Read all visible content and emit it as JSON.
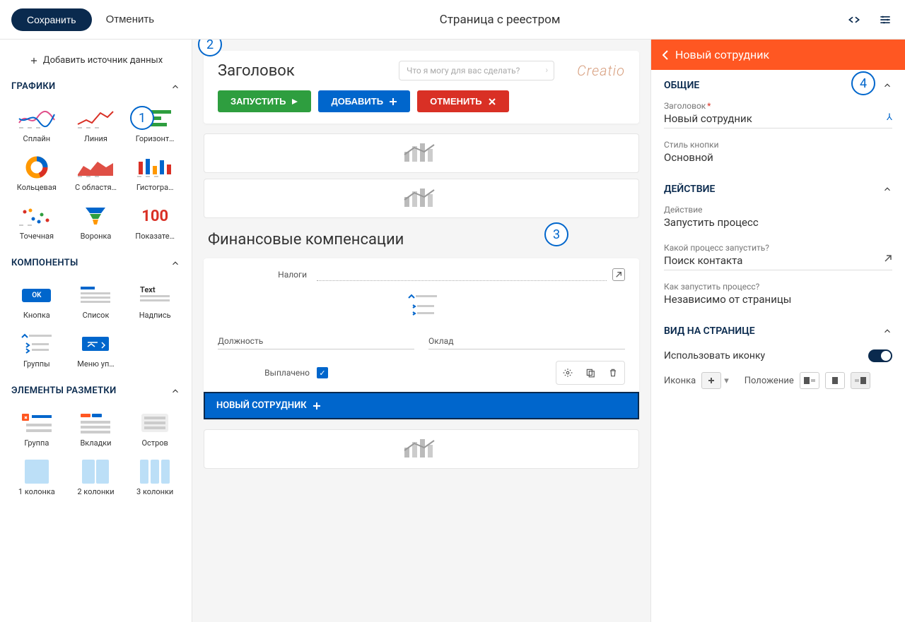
{
  "topbar": {
    "save": "Сохранить",
    "cancel": "Отменить",
    "title": "Страница с реестром"
  },
  "steps": [
    "1",
    "2",
    "3",
    "4"
  ],
  "left": {
    "add_source": "Добавить источник данных",
    "sections": {
      "graphics": "ГРАФИКИ",
      "components": "КОМПОНЕНТЫ",
      "layout": "ЭЛЕМЕНТЫ РАЗМЕТКИ"
    },
    "graphics": [
      {
        "label": "Сплайн"
      },
      {
        "label": "Линия"
      },
      {
        "label": "Горизонт…"
      },
      {
        "label": "Кольцевая"
      },
      {
        "label": "С областя…"
      },
      {
        "label": "Гистогра…"
      },
      {
        "label": "Точечная"
      },
      {
        "label": "Воронка"
      },
      {
        "label": "Показате…",
        "value": "100"
      }
    ],
    "components": [
      {
        "label": "Кнопка",
        "inner": "OK"
      },
      {
        "label": "Список"
      },
      {
        "label": "Надпись",
        "inner": "Text"
      },
      {
        "label": "Группы"
      },
      {
        "label": "Меню уп…"
      }
    ],
    "layout": [
      {
        "label": "Группа"
      },
      {
        "label": "Вкладки"
      },
      {
        "label": "Остров"
      },
      {
        "label": "1 колонка"
      },
      {
        "label": "2 колонки"
      },
      {
        "label": "3 колонки"
      }
    ]
  },
  "canvas": {
    "header_title": "Заголовок",
    "search_placeholder": "Что я могу для вас сделать?",
    "logo": "Creatio",
    "actions": {
      "run": "ЗАПУСТИТЬ",
      "add": "ДОБАВИТЬ",
      "cancel": "ОТМЕНИТЬ"
    },
    "section_title": "Финансовые компенсации",
    "fields": {
      "taxes": "Налоги",
      "position": "Должность",
      "salary": "Оклад",
      "paid": "Выплачено"
    },
    "selected_button": "НОВЫЙ СОТРУДНИК"
  },
  "right": {
    "header": "Новый сотрудник",
    "sections": {
      "general": "ОБЩИЕ",
      "action": "ДЕЙСТВИЕ",
      "view": "ВИД НА СТРАНИЦЕ"
    },
    "general": {
      "title_label": "Заголовок",
      "title_value": "Новый сотрудник",
      "style_label": "Стиль кнопки",
      "style_value": "Основной"
    },
    "action": {
      "action_label": "Действие",
      "action_value": "Запустить процесс",
      "which_label": "Какой процесс запустить?",
      "which_value": "Поиск контакта",
      "how_label": "Как запустить процесс?",
      "how_value": "Независимо от страницы"
    },
    "view": {
      "use_icon": "Использовать иконку",
      "icon_label": "Иконка",
      "position_label": "Положение"
    }
  }
}
